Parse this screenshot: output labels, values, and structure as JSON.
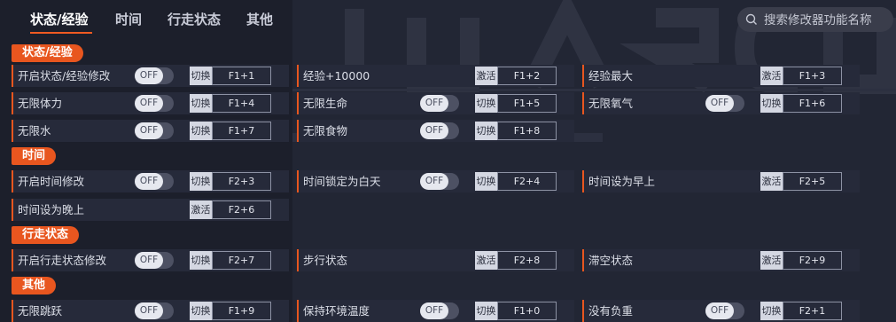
{
  "nav": {
    "tabs": [
      "状态/经验",
      "时间",
      "行走状态",
      "其他"
    ],
    "search_placeholder": "搜索修改器功能名称"
  },
  "colors": {
    "accent": "#e8561f",
    "background": "#1c1f2b",
    "row": "#262a3a"
  },
  "sections": [
    {
      "title": "状态/经验",
      "rows": [
        [
          {
            "label": "开启状态/经验修改",
            "toggle": "OFF",
            "action": "切换",
            "key": "F1+1"
          },
          {
            "label": "经验+10000",
            "action": "激活",
            "key": "F1+2"
          },
          {
            "label": "经验最大",
            "action": "激活",
            "key": "F1+3"
          }
        ],
        [
          {
            "label": "无限体力",
            "toggle": "OFF",
            "action": "切换",
            "key": "F1+4"
          },
          {
            "label": "无限生命",
            "toggle": "OFF",
            "action": "切换",
            "key": "F1+5"
          },
          {
            "label": "无限氧气",
            "toggle": "OFF",
            "action": "切换",
            "key": "F1+6"
          }
        ],
        [
          {
            "label": "无限水",
            "toggle": "OFF",
            "action": "切换",
            "key": "F1+7"
          },
          {
            "label": "无限食物",
            "toggle": "OFF",
            "action": "切换",
            "key": "F1+8"
          }
        ]
      ]
    },
    {
      "title": "时间",
      "rows": [
        [
          {
            "label": "开启时间修改",
            "toggle": "OFF",
            "action": "切换",
            "key": "F2+3"
          },
          {
            "label": "时间锁定为白天",
            "toggle": "OFF",
            "action": "切换",
            "key": "F2+4"
          },
          {
            "label": "时间设为早上",
            "action": "激活",
            "key": "F2+5"
          }
        ],
        [
          {
            "label": "时间设为晚上",
            "action": "激活",
            "key": "F2+6"
          }
        ]
      ]
    },
    {
      "title": "行走状态",
      "rows": [
        [
          {
            "label": "开启行走状态修改",
            "toggle": "OFF",
            "action": "切换",
            "key": "F2+7"
          },
          {
            "label": "步行状态",
            "action": "激活",
            "key": "F2+8"
          },
          {
            "label": "滞空状态",
            "action": "激活",
            "key": "F2+9"
          }
        ]
      ]
    },
    {
      "title": "其他",
      "rows": [
        [
          {
            "label": "无限跳跃",
            "toggle": "OFF",
            "action": "切换",
            "key": "F1+9"
          },
          {
            "label": "保持环境温度",
            "toggle": "OFF",
            "action": "切换",
            "key": "F1+0"
          },
          {
            "label": "没有负重",
            "toggle": "OFF",
            "action": "切换",
            "key": "F2+1"
          }
        ]
      ]
    }
  ]
}
